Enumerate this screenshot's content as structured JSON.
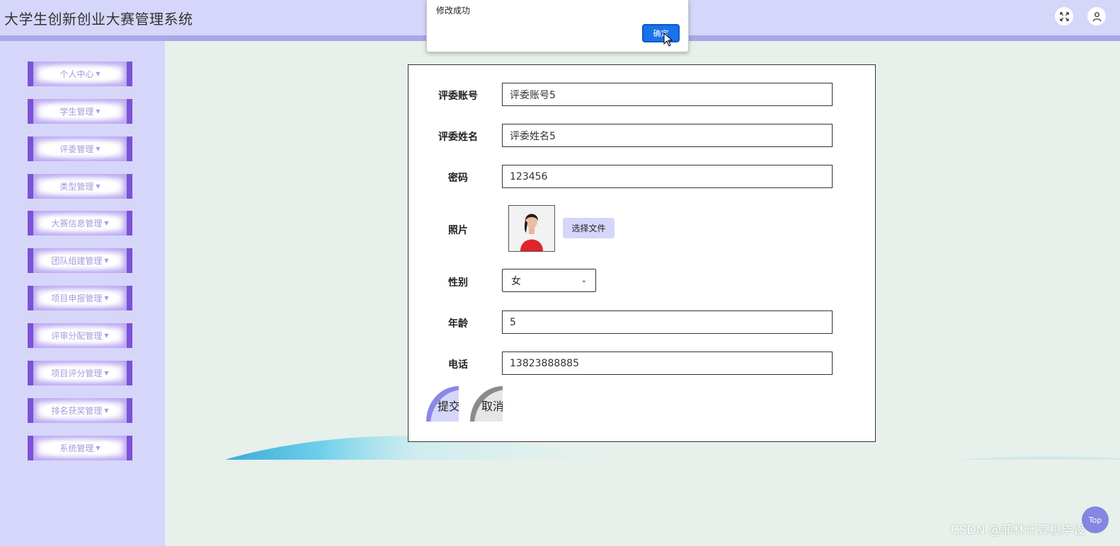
{
  "header": {
    "title": "大学生创新创业大赛管理系统",
    "fullscreen_icon": "fullscreen-icon",
    "user_icon": "user-icon"
  },
  "sidebar": {
    "items": [
      {
        "label": "个人中心"
      },
      {
        "label": "学生管理"
      },
      {
        "label": "评委管理"
      },
      {
        "label": "类型管理"
      },
      {
        "label": "大赛信息管理"
      },
      {
        "label": "团队组建管理"
      },
      {
        "label": "项目申报管理"
      },
      {
        "label": "评审分配管理"
      },
      {
        "label": "项目评分管理"
      },
      {
        "label": "排名获奖管理"
      },
      {
        "label": "系统管理"
      }
    ]
  },
  "form": {
    "account_label": "评委账号",
    "account_value": "评委账号5",
    "name_label": "评委姓名",
    "name_value": "评委姓名5",
    "password_label": "密码",
    "password_value": "123456",
    "photo_label": "照片",
    "file_button": "选择文件",
    "gender_label": "性别",
    "gender_value": "女",
    "age_label": "年龄",
    "age_value": "5",
    "phone_label": "电话",
    "phone_value": "13823888885",
    "submit_label": "提交",
    "cancel_label": "取消"
  },
  "dialog": {
    "message": "修改成功",
    "ok_label": "确定"
  },
  "floating": {
    "top_label": "Top"
  },
  "watermark": "CSDN @菲林计算机毕设",
  "colors": {
    "header_bg": "#d6d6fa",
    "accent_purple": "#7b52d6",
    "content_bg": "#e7f0ea",
    "dialog_button": "#1a73e8"
  }
}
